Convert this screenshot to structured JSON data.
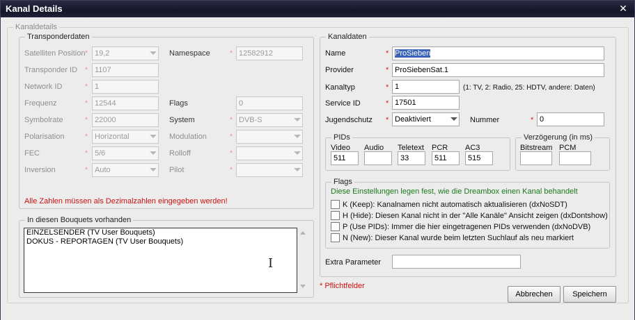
{
  "window": {
    "title": "Kanal Details",
    "close_glyph": "✕"
  },
  "kanaldetails_legend": "Kanaldetails",
  "transponder": {
    "legend": "Transponderdaten",
    "satelliten_label": "Satelliten Position",
    "satelliten_value": "19,2",
    "namespace_label": "Namespace",
    "namespace_value": "12582912",
    "transponder_id_label": "Transponder ID",
    "transponder_id_value": "1107",
    "network_id_label": "Network ID",
    "network_id_value": "1",
    "frequenz_label": "Frequenz",
    "frequenz_value": "12544",
    "flags_label": "Flags",
    "flags_value": "0",
    "symbolrate_label": "Symbolrate",
    "symbolrate_value": "22000",
    "system_label": "System",
    "system_value": "DVB-S",
    "polarisation_label": "Polarisation",
    "polarisation_value": "Horizontal",
    "modulation_label": "Modulation",
    "modulation_value": "",
    "fec_label": "FEC",
    "fec_value": "5/6",
    "rolloff_label": "Rolloff",
    "rolloff_value": "",
    "inversion_label": "Inversion",
    "inversion_value": "Auto",
    "pilot_label": "Pilot",
    "pilot_value": "",
    "warning": "Alle Zahlen müssen als Dezimalzahlen eingegeben werden!"
  },
  "bouquets": {
    "legend": "In diesen Bouquets vorhanden",
    "items": [
      "EINZELSENDER  (TV User Bouquets)",
      "DOKUS - REPORTAGEN (TV User Bouquets)"
    ]
  },
  "kanaldaten": {
    "legend": "Kanaldaten",
    "name_label": "Name",
    "name_value": "ProSieben",
    "provider_label": "Provider",
    "provider_value": "ProSiebenSat.1",
    "kanaltyp_label": "Kanaltyp",
    "kanaltyp_value": "1",
    "kanaltyp_hint": "(1: TV, 2: Radio, 25: HDTV, andere: Daten)",
    "service_id_label": "Service ID",
    "service_id_value": "17501",
    "jugendschutz_label": "Jugendschutz",
    "jugendschutz_value": "Deaktiviert",
    "nummer_label": "Nummer",
    "nummer_value": "0"
  },
  "pids": {
    "legend": "PIDs",
    "video_label": "Video",
    "video_value": "511",
    "audio_label": "Audio",
    "audio_value": "",
    "teletext_label": "Teletext",
    "teletext_value": "33",
    "pcr_label": "PCR",
    "pcr_value": "511",
    "ac3_label": "AC3",
    "ac3_value": "515"
  },
  "verzoegerung": {
    "legend": "Verzögerung (in ms)",
    "bitstream_label": "Bitstream",
    "bitstream_value": "",
    "pcm_label": "PCM",
    "pcm_value": ""
  },
  "flags": {
    "legend": "Flags",
    "description": "Diese Einstellungen legen fest, wie die Dreambox einen Kanal behandelt",
    "k_label": "K (Keep): Kanalnamen nicht automatisch aktualisieren (dxNoSDT)",
    "h_label": "H (Hide): Diesen Kanal nicht in der \"Alle Kanäle\" Ansicht zeigen (dxDontshow)",
    "p_label": "P (Use PIDs): Immer die hier eingetragenen PIDs verwenden (dxNoDVB)",
    "n_label": "N (New): Dieser Kanal wurde beim letzten Suchlauf als neu markiert"
  },
  "extra_parameter_label": "Extra Parameter",
  "extra_parameter_value": "",
  "required_note": "* Pflichtfelder",
  "required_star": "*",
  "buttons": {
    "cancel": "Abbrechen",
    "save": "Speichern"
  }
}
